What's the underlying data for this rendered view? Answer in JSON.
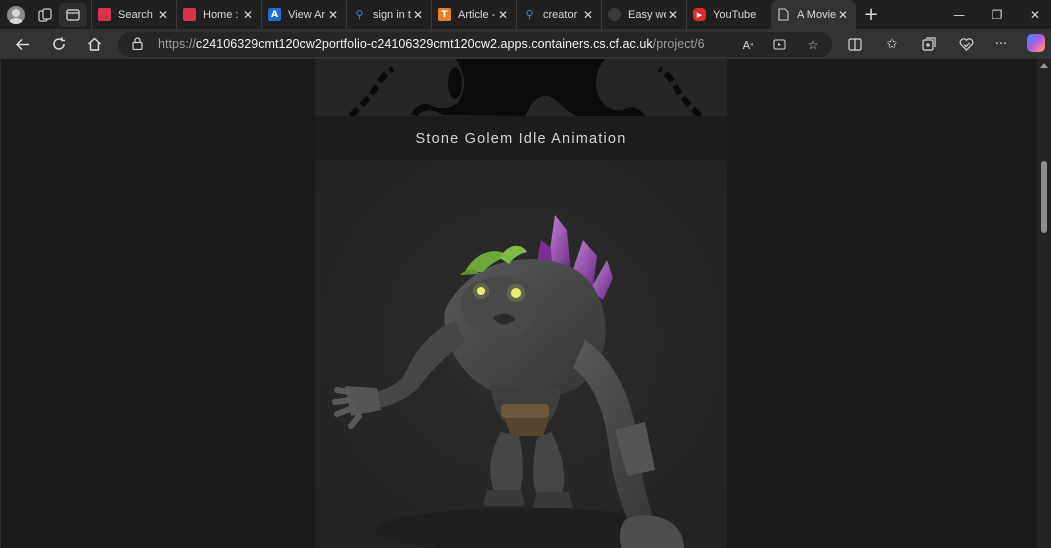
{
  "browser": {
    "tabs": [
      {
        "title": "Search",
        "favicon": "red-grid-favicon",
        "color": "#d8334a"
      },
      {
        "title": "Home :",
        "favicon": "red-grid-favicon",
        "color": "#d8334a"
      },
      {
        "title": "View Ar",
        "favicon": "azure-devops-favicon",
        "color": "#1f6fd1"
      },
      {
        "title": "sign in t",
        "favicon": "search-favicon",
        "color": "#2d8ae8"
      },
      {
        "title": "Article -",
        "favicon": "t-favicon",
        "color": "#e8822a"
      },
      {
        "title": "creator",
        "favicon": "search-favicon",
        "color": "#2d8ae8"
      },
      {
        "title": "Easy we",
        "favicon": "github-favicon",
        "color": "#3b3b3b"
      },
      {
        "title": "YouTube",
        "favicon": "youtube-favicon",
        "color": "#e02a2a"
      },
      {
        "title": "A Movie",
        "favicon": "page-favicon",
        "color": "#cfcfcf",
        "active": true
      }
    ],
    "address": {
      "prefix": "https://",
      "host": "c24106329cmt120cw2portfolio-c24106329cmt120cw2.apps.containers.cs.cf.ac.uk",
      "path": "/project/6"
    }
  },
  "page": {
    "caption": "Stone Golem Idle Animation"
  },
  "colors": {
    "accent_crystal": "#9b3fb5",
    "golem_eyes": "#e8f070",
    "moss": "#6fa83a"
  }
}
